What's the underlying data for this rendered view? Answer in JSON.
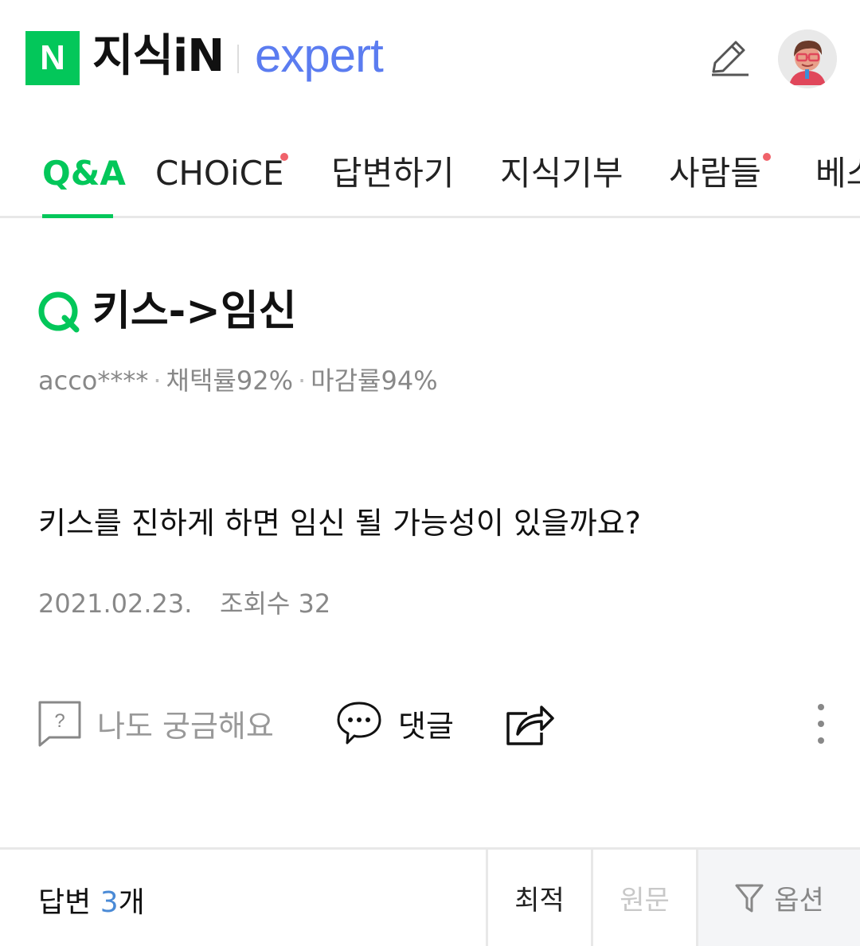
{
  "header": {
    "logo_letter": "N",
    "logo_text": "지식iN",
    "expert_text": "expert",
    "write_icon": "pencil-icon",
    "avatar_icon": "user-avatar-icon"
  },
  "tabs": [
    {
      "label": "Q&A",
      "active": true
    },
    {
      "label": "CHOiCE",
      "has_dot": true
    },
    {
      "label": "답변하기"
    },
    {
      "label": "지식기부"
    },
    {
      "label": "사람들",
      "has_dot": true
    },
    {
      "label": "베스"
    }
  ],
  "question": {
    "title": "키스->임신",
    "author": "acco****",
    "adoption_rate": "채택률92%",
    "close_rate": "마감률94%",
    "body": "키스를 진하게 하면 임신 될 가능성이 있을까요?",
    "date": "2021.02.23.",
    "views": "조회수 32"
  },
  "actions": {
    "curious_label": "나도 궁금해요",
    "comment_label": "댓글"
  },
  "answers": {
    "label_prefix": "답변 ",
    "count": "3",
    "label_suffix": "개",
    "sort_best": "최적",
    "sort_original": "원문",
    "options_label": "옵션"
  },
  "colors": {
    "brand_green": "#03c75a",
    "expert_blue": "#5b7cf0",
    "dot_red": "#f0626a",
    "answer_count_blue": "#4a8ad6"
  }
}
